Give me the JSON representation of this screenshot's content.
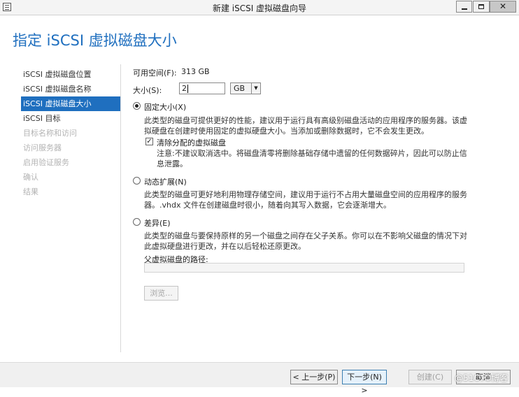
{
  "window": {
    "title": "新建 iSCSI 虚拟磁盘向导",
    "controls": {
      "minimize": "",
      "maximize": "",
      "close": ""
    }
  },
  "page_title": "指定 iSCSI 虚拟磁盘大小",
  "nav": {
    "items": [
      {
        "label": "iSCSI 虚拟磁盘位置",
        "state": "normal"
      },
      {
        "label": "iSCSI 虚拟磁盘名称",
        "state": "normal"
      },
      {
        "label": "iSCSI 虚拟磁盘大小",
        "state": "active"
      },
      {
        "label": "iSCSI 目标",
        "state": "normal"
      },
      {
        "label": "目标名称和访问",
        "state": "disabled"
      },
      {
        "label": "访问服务器",
        "state": "disabled"
      },
      {
        "label": "启用验证服务",
        "state": "disabled"
      },
      {
        "label": "确认",
        "state": "disabled"
      },
      {
        "label": "结果",
        "state": "disabled"
      }
    ]
  },
  "form": {
    "free_space_label": "可用空间(F):",
    "free_space_value": "313 GB",
    "size_label": "大小(S):",
    "size_value": "2",
    "unit_value": "GB",
    "fixed": {
      "label": "固定大小(X)",
      "selected": true,
      "desc_line1": "此类型的磁盘可提供更好的性能，建议用于运行具有高级别磁盘活动的应用程序的服务器。该虚",
      "desc_line2": "拟硬盘在创建时使用固定的虚拟硬盘大小。当添加或删除数据时，它不会发生更改。",
      "clear_label": "清除分配的虚拟磁盘",
      "clear_checked": true,
      "note_line1": "注意:不建议取消选中。将磁盘清零将删除基础存储中遗留的任何数据碎片，因此可以防止信",
      "note_line2": "息泄露。"
    },
    "dynamic": {
      "label": "动态扩展(N)",
      "selected": false,
      "desc_line1": "此类型的磁盘可更好地利用物理存储空间，建议用于运行不占用大量磁盘空间的应用程序的服务",
      "desc_line2": "器。.vhdx 文件在创建磁盘时很小，随着向其写入数据，它会逐渐增大。"
    },
    "differencing": {
      "label": "差异(E)",
      "selected": false,
      "desc_line1": "此类型的磁盘与要保持原样的另一个磁盘之间存在父子关系。你可以在不影响父磁盘的情况下对",
      "desc_line2": "此虚拟硬盘进行更改，并在以后轻松还原更改。",
      "parent_path_label": "父虚拟磁盘的路径:",
      "parent_path_value": "",
      "browse_label": "浏览..."
    }
  },
  "footer": {
    "prev_label": "< 上一步(P)",
    "next_label": "下一步(N) >",
    "create_label": "创建(C)",
    "cancel_label": "取消",
    "watermark": "@51CTO博客"
  }
}
